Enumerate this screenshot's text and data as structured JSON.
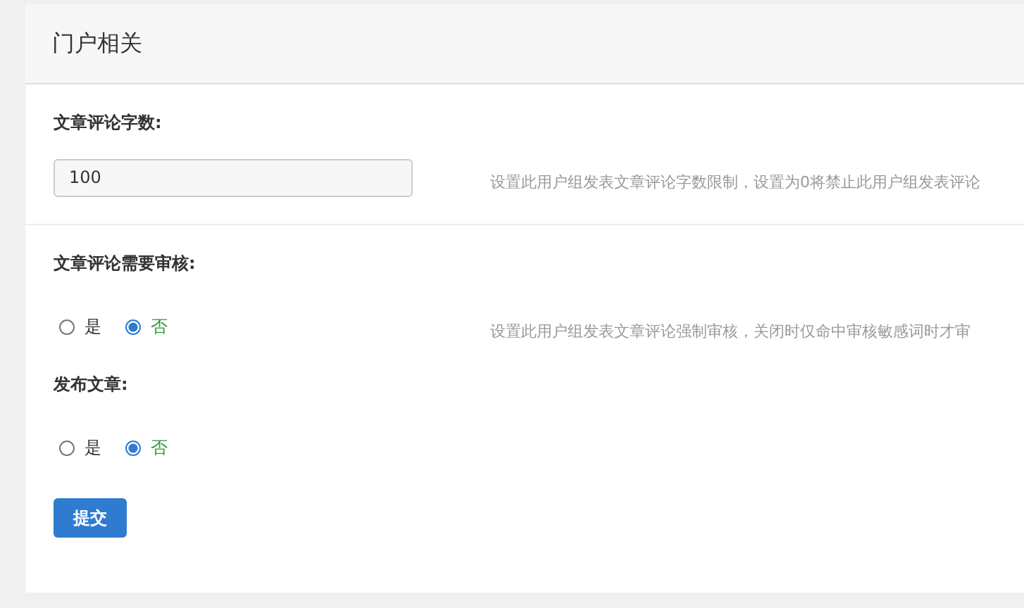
{
  "panel": {
    "title": "门户相关"
  },
  "settings": [
    {
      "kind": "text",
      "label": "文章评论字数:",
      "value": "100",
      "hint": "设置此用户组发表文章评论字数限制，设置为0将禁止此用户组发表评论"
    },
    {
      "kind": "radio",
      "label": "文章评论需要审核:",
      "options": [
        {
          "label": "是",
          "selected": false
        },
        {
          "label": "否",
          "selected": true
        }
      ],
      "hint": "设置此用户组发表文章评论强制审核，关闭时仅命中审核敏感词时才审"
    },
    {
      "kind": "radio",
      "label": "发布文章:",
      "options": [
        {
          "label": "是",
          "selected": false
        },
        {
          "label": "否",
          "selected": true
        }
      ]
    }
  ],
  "submit": "提交"
}
